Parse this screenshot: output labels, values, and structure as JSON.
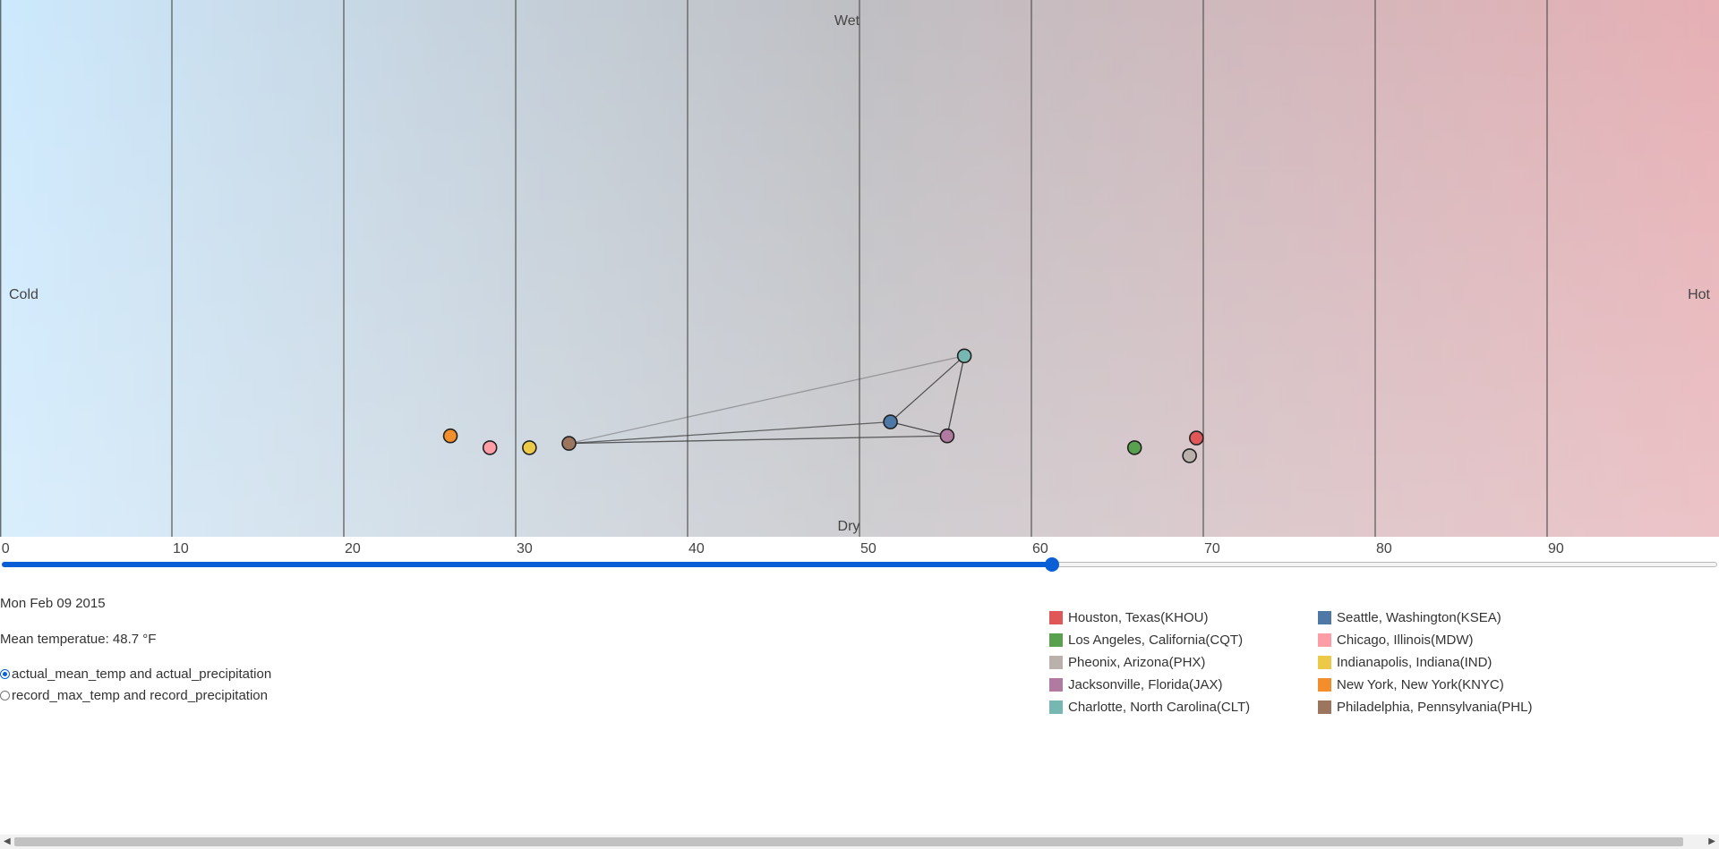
{
  "chart_data": {
    "type": "scatter",
    "xlim": [
      0,
      100
    ],
    "ylim": [
      0,
      100
    ],
    "x_ticks": [
      0,
      10,
      20,
      30,
      40,
      50,
      60,
      70,
      80,
      90
    ],
    "grid": "vertical lines at each x tick",
    "region_labels": {
      "top": "Wet",
      "bottom": "Dry",
      "left": "Cold",
      "right": "Hot"
    },
    "background_gradient": {
      "cold_color": "#cde9fd",
      "hot_color": "#e6b0b5",
      "neutral_color": "#bfbfc3"
    },
    "series": [
      {
        "name": "Houston, Texas(KHOU)",
        "color": "#e05759",
        "x": 69.6,
        "y": 18.4
      },
      {
        "name": "Seattle, Washington(KSEA)",
        "color": "#4e79a7",
        "x": 51.8,
        "y": 21.4
      },
      {
        "name": "Los Angeles, California(CQT)",
        "color": "#59a14f",
        "x": 66.0,
        "y": 16.6
      },
      {
        "name": "Chicago, Illinois(MDW)",
        "color": "#ff9da7",
        "x": 28.5,
        "y": 16.6
      },
      {
        "name": "Pheonix, Arizona(PHX)",
        "color": "#bab0ac",
        "x": 69.2,
        "y": 15.1
      },
      {
        "name": "Indianapolis, Indiana(IND)",
        "color": "#edc948",
        "x": 30.8,
        "y": 16.6
      },
      {
        "name": "Jacksonville, Florida(JAX)",
        "color": "#b07aa1",
        "x": 55.1,
        "y": 18.8
      },
      {
        "name": "New York, New York(KNYC)",
        "color": "#f28e2b",
        "x": 26.2,
        "y": 18.8
      },
      {
        "name": "Charlotte, North Carolina(CLT)",
        "color": "#76b7b2",
        "x": 56.1,
        "y": 33.7
      },
      {
        "name": "Philadelphia, Pennsylvania(PHL)",
        "color": "#9c755f",
        "x": 33.1,
        "y": 17.4
      }
    ],
    "links": [
      {
        "from": 9,
        "to": 1,
        "opacity": 0.7
      },
      {
        "from": 9,
        "to": 6,
        "opacity": 0.75
      },
      {
        "from": 1,
        "to": 6,
        "opacity": 0.85
      },
      {
        "from": 6,
        "to": 8,
        "opacity": 0.85
      },
      {
        "from": 1,
        "to": 8,
        "opacity": 0.8
      },
      {
        "from": 9,
        "to": 8,
        "opacity": 0.35
      }
    ]
  },
  "slider": {
    "fraction": 0.612
  },
  "info": {
    "date": "Mon Feb 09 2015",
    "mean_temp": "Mean temperatue: 48.7 °F"
  },
  "radios": [
    {
      "label": "actual_mean_temp and actual_precipitation",
      "checked": true
    },
    {
      "label": "record_max_temp and record_precipitation",
      "checked": false
    }
  ]
}
